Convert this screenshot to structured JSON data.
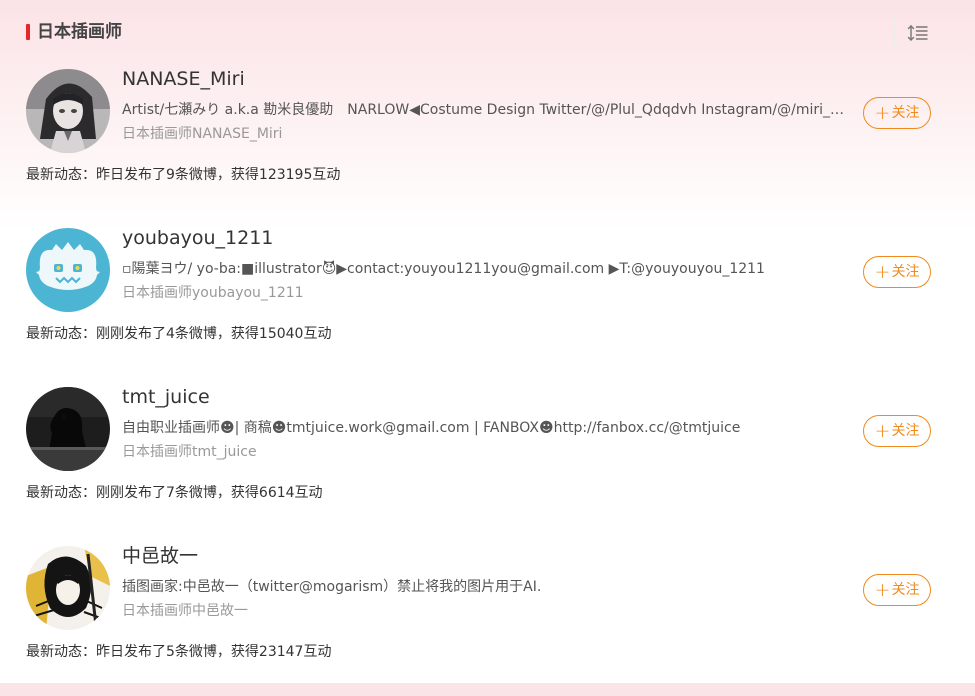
{
  "header": {
    "title": "日本插画师",
    "sort_icon": "sort-lines-icon"
  },
  "follow_label": "关注",
  "accent_color": "#f08a1d",
  "title_bar_color": "#e5262b",
  "users": [
    {
      "name": "NANASE_Miri",
      "desc": "Artist/七瀬みり a.k.a 勘米良優助　NARLOW◀Costume Design Twitter/@/Plul_Qdqdvh Instagram/@/miri_nanase_",
      "tag": "日本插画师NANASE_Miri",
      "recent": "最新动态：昨日发布了9条微博，获得123195互动"
    },
    {
      "name": "youbayou_1211",
      "desc": "▫陽葉ヨウ/ yo-ba:■illustrator😈▶contact:youyou1211you@gmail.com ▶T:@youyouyou_1211",
      "tag": "日本插画师youbayou_1211",
      "recent": "最新动态：刚刚发布了4条微博，获得15040互动"
    },
    {
      "name": "tmt_juice",
      "desc": "自由职业插画师☻| 商稿☻tmtjuice.work@gmail.com | FANBOX☻http://fanbox.cc/@tmtjuice",
      "tag": "日本插画师tmt_juice",
      "recent": "最新动态：刚刚发布了7条微博，获得6614互动"
    },
    {
      "name": "中邑故一",
      "desc": "插图画家:中邑故一（twitter@mogarism）禁止将我的图片用于AI.",
      "tag": "日本插画师中邑故一",
      "recent": "最新动态：昨日发布了5条微博，获得23147互动"
    }
  ]
}
